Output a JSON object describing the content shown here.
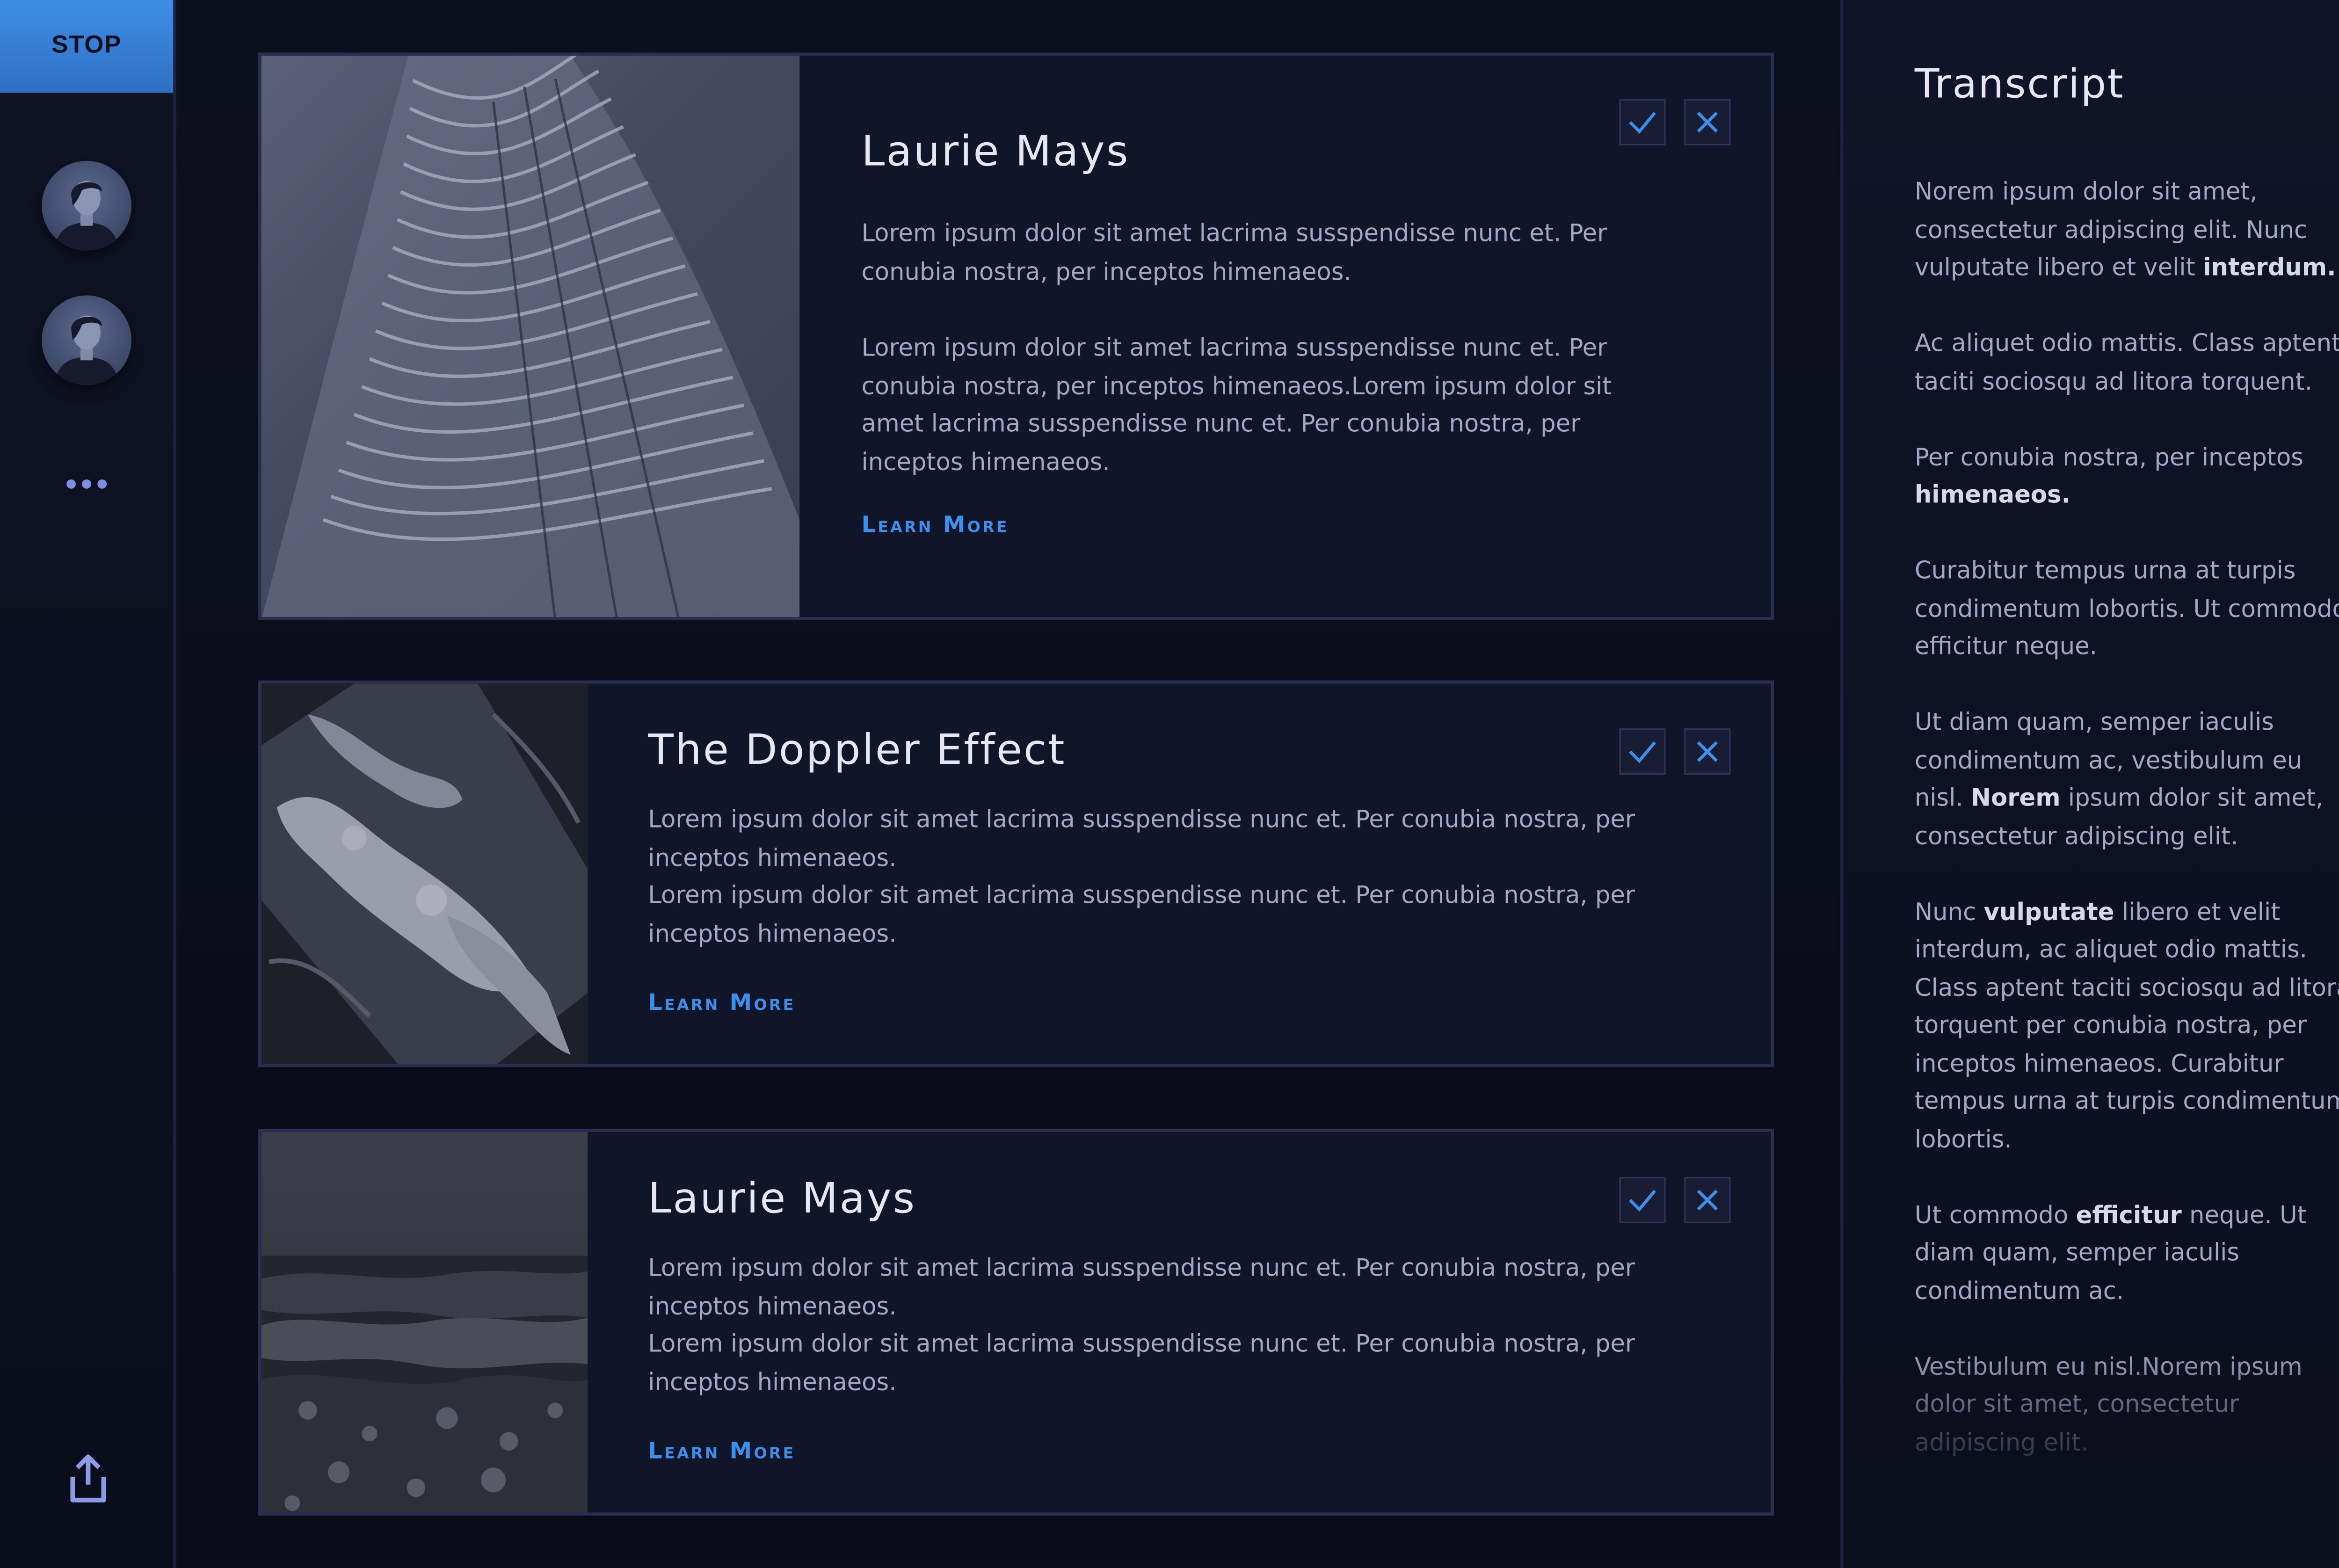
{
  "sidebar": {
    "stop_label": "STOP",
    "avatars": [
      "avatar-person",
      "avatar-person"
    ],
    "more_icon": "ellipsis-icon",
    "share_icon": "share-upload-icon"
  },
  "cards": [
    {
      "title": "Laurie Mays",
      "paragraphs": [
        "Lorem ipsum dolor sit amet lacrima susspendisse nunc et. Per conubia nostra, per inceptos himenaeos.",
        "Lorem ipsum dolor sit amet lacrima susspendisse nunc et. Per conubia nostra, per inceptos himenaeos.Lorem ipsum dolor sit amet lacrima susspendisse nunc et. Per conubia nostra, per inceptos himenaeos."
      ],
      "cta": "Learn More",
      "image": "wavy-skyscraper-photo"
    },
    {
      "title": "The Doppler Effect",
      "paragraphs": [
        "Lorem ipsum dolor sit amet lacrima susspendisse nunc et. Per conubia nostra, per inceptos himenaeos.",
        "Lorem ipsum dolor sit amet lacrima susspendisse nunc et. Per conubia nostra, per inceptos himenaeos."
      ],
      "cta": "Learn More",
      "image": "marble-texture-photo"
    },
    {
      "title": "Laurie Mays",
      "paragraphs": [
        "Lorem ipsum dolor sit amet lacrima susspendisse nunc et. Per conubia nostra, per inceptos himenaeos.",
        "Lorem ipsum dolor sit amet lacrima susspendisse nunc et. Per conubia nostra, per inceptos himenaeos."
      ],
      "cta": "Learn More",
      "image": "ocean-waves-photo"
    }
  ],
  "card_actions": {
    "accept_icon": "check-icon",
    "reject_icon": "close-icon"
  },
  "transcript": {
    "title": "Transcript",
    "paragraphs": [
      [
        {
          "t": "Norem ipsum dolor sit amet, consectetur adipiscing elit. Nunc vulputate libero et velit "
        },
        {
          "t": "interdum.",
          "b": true
        }
      ],
      [
        {
          "t": "Ac aliquet odio mattis. Class aptent taciti sociosqu ad litora torquent."
        }
      ],
      [
        {
          "t": "Per conubia nostra, per inceptos "
        },
        {
          "t": "himenaeos.",
          "b": true
        }
      ],
      [
        {
          "t": "Curabitur tempus urna at turpis condimentum lobortis. Ut commodo efficitur neque."
        }
      ],
      [
        {
          "t": "Ut diam quam, semper iaculis condimentum ac, vestibulum eu nisl. "
        },
        {
          "t": "Norem",
          "b": true
        },
        {
          "t": " ipsum dolor sit amet, consectetur adipiscing elit."
        }
      ],
      [
        {
          "t": "Nunc "
        },
        {
          "t": "vulputate",
          "b": true
        },
        {
          "t": " libero et velit interdum, ac aliquet odio mattis. Class aptent taciti sociosqu ad litora torquent per conubia nostra, per inceptos himenaeos. Curabitur tempus urna at turpis condimentum lobortis."
        }
      ],
      [
        {
          "t": "Ut commodo "
        },
        {
          "t": "efficitur",
          "b": true
        },
        {
          "t": " neque. Ut diam quam, semper iaculis condimentum ac."
        }
      ],
      [
        {
          "t": "Vestibulum eu nisl.Norem ipsum dolor sit amet, consectetur adipiscing elit."
        }
      ]
    ]
  },
  "colors": {
    "accent": "#3f8fe9",
    "background": "#0b0e1c",
    "card": "#11152a",
    "border": "#2a2f52"
  }
}
